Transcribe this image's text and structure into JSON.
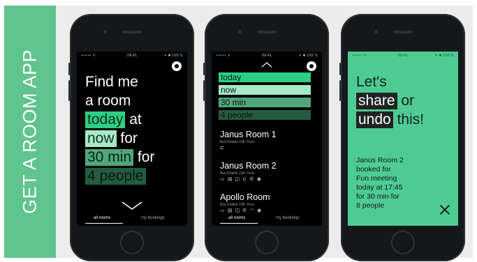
{
  "banner": {
    "title": "GET A ROOM APP"
  },
  "status_bar": {
    "left": "••••• ᯤ",
    "time": "09:41",
    "right": "✈ ✱ 100 %"
  },
  "phone1": {
    "line1": "Find me",
    "line2": "a room",
    "date_value": "today",
    "word_at": "at",
    "time_value": "now",
    "word_for1": "for",
    "duration_value": "30 min",
    "word_for2": "for",
    "people_value": "4 people",
    "tabs": {
      "all_rooms": "all rooms",
      "my_bookings": "my bookings"
    }
  },
  "phone2": {
    "filters": [
      "today",
      "now",
      "30 min",
      "4 people"
    ],
    "rooms": [
      {
        "name": "Janus Room 1",
        "location": "Burj Khalifa 108. Floor",
        "icons": "⊏"
      },
      {
        "name": "Janus Room 2",
        "location": "Burj Khalifa 108. Floor",
        "icons": "▭ ▤ ◫ ⊏ ✆ ◉"
      },
      {
        "name": "Apollo Room",
        "location": "Burj Khalifa 108. Floor",
        "icons": "▭ ▤ ◫ ✆ ◠ ◉"
      }
    ],
    "tabs": {
      "all_rooms": "all rooms",
      "my_bookings": "my bookings"
    }
  },
  "phone3": {
    "line1": "Let's",
    "share_label": "share",
    "word_or": "or",
    "undo_label": "undo",
    "word_this": "this!",
    "confirmation": "Janus Room 2\nbooked for\nFun meeting\ntoday at 17:45\nfor 30 min for\n8 people"
  },
  "colors": {
    "banner": "#5fc48d",
    "today": "#2cd083",
    "now": "#a7e8c6",
    "duration": "#4fa67a",
    "people": "#235c40",
    "green_screen": "#4ecb93"
  }
}
